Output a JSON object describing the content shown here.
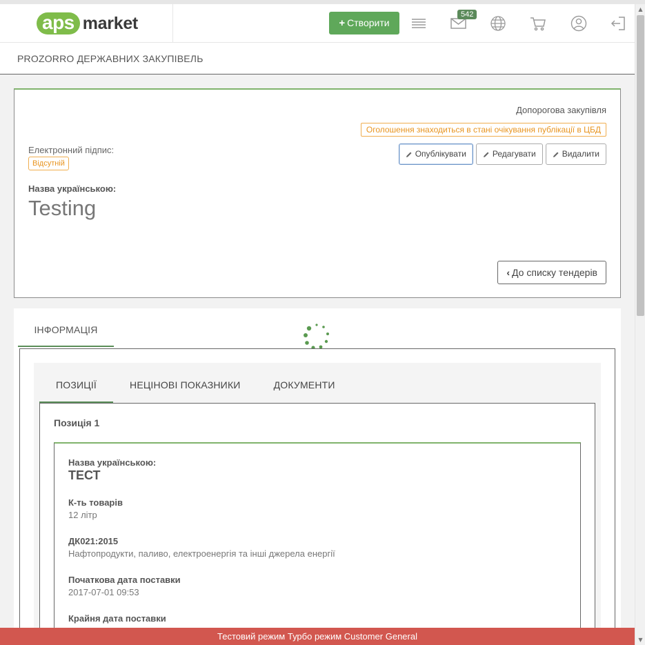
{
  "header": {
    "logo_badge": "aps",
    "logo_text": "market",
    "create_label": "Створити",
    "messages_count": "542",
    "icons": [
      "menu-icon",
      "mail-icon",
      "globe-icon",
      "cart-icon",
      "user-icon",
      "logout-icon"
    ]
  },
  "subheader": {
    "title": "PROZORRO ДЕРЖАВНИХ ЗАКУПІВЕЛЬ"
  },
  "tender": {
    "procurement_type": "Допорогова закупівля",
    "status_note": "Оголошення знаходиться в стані очікування публікації в ЦБД",
    "actions": {
      "publish": "Опублікувати",
      "edit": "Редагувати",
      "delete": "Видалити"
    },
    "esig_label": "Електронний підпис:",
    "esig_status": "Відсутній",
    "name_label": "Назва українською:",
    "name_value": "Testing",
    "back_label": "До списку тендерів"
  },
  "info": {
    "tab_label": "ІНФОРМАЦІЯ",
    "tabs": [
      "ПОЗИЦІЇ",
      "НЕЦІНОВІ ПОКАЗНИКИ",
      "ДОКУМЕНТИ"
    ],
    "position_title": "Позиція 1",
    "item": {
      "name_label": "Назва українською:",
      "name_value": "ТЕСТ",
      "qty_label": "К-ть товарів",
      "qty_value": "12 літр",
      "dk_label": "ДК021:2015",
      "dk_value": "Нафтопродукти, паливо, електроенергія та інші джерела енергії",
      "start_label": "Початкова дата поставки",
      "start_value": "2017-07-01 09:53",
      "end_label": "Крайня дата поставки"
    }
  },
  "footer": {
    "text": "Тестовий режим Турбо режим Customer General"
  },
  "colors": {
    "accent_green": "#5fa85a",
    "warning_orange": "#f0ad4e",
    "footer_red": "#d2574f"
  }
}
